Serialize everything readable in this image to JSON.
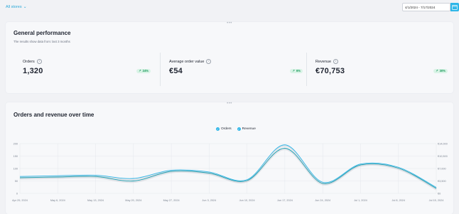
{
  "header": {
    "store_selector": "All stores",
    "date_range": "4/1/2024 - 7/17/2024"
  },
  "general": {
    "title": "General performance",
    "subtitle": "The results show data from: last 3 months",
    "metrics": [
      {
        "label": "Orders",
        "value": "1,320",
        "change": "24%"
      },
      {
        "label": "Average order value",
        "value": "€54",
        "change": "6%"
      },
      {
        "label": "Revenue",
        "value": "€70,753",
        "change": "30%"
      }
    ]
  },
  "chart_section": {
    "title": "Orders and revenue over time",
    "legend": [
      "Orders",
      "Revenue"
    ]
  },
  "chart_data": {
    "type": "line",
    "x": [
      "Apr 29, 2024",
      "May 6, 2024",
      "May 13, 2024",
      "May 20, 2024",
      "May 27, 2024",
      "Jun 3, 2024",
      "Jun 10, 2024",
      "Jun 17, 2024",
      "Jun 24, 2024",
      "Jul 1, 2024",
      "Jul 8, 2024",
      "Jul 15, 2024"
    ],
    "y_left_ticks": [
      "0",
      "50",
      "100",
      "150",
      "200"
    ],
    "y_right_ticks": [
      "€0",
      "€3,500",
      "€7,000",
      "€10,500",
      "€14,000"
    ],
    "series": [
      {
        "name": "Orders",
        "axis": "left",
        "values": [
          68,
          71,
          73,
          60,
          93,
          86,
          55,
          195,
          45,
          118,
          105,
          24
        ]
      },
      {
        "name": "Revenue",
        "axis": "right",
        "values": [
          4400,
          4600,
          4750,
          3500,
          6200,
          5700,
          3600,
          12700,
          2800,
          8000,
          7100,
          1400
        ]
      }
    ],
    "colors": {
      "orders": "#2eb6e8",
      "revenue": "#1f9fb0"
    }
  }
}
